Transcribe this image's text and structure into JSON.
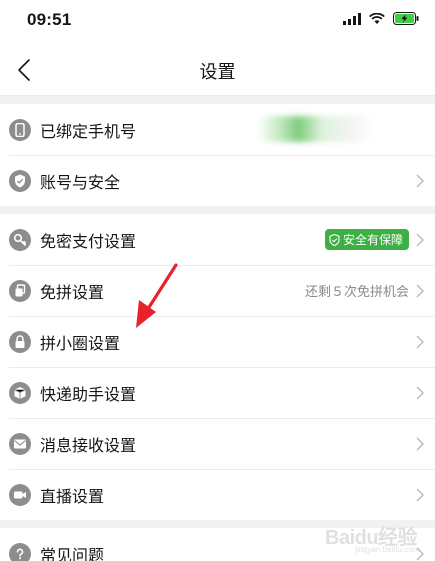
{
  "status": {
    "time": "09:51"
  },
  "nav": {
    "title": "设置"
  },
  "groups": [
    {
      "rows": [
        {
          "label": "已绑定手机号",
          "icon": "phone-icon"
        },
        {
          "label": "账号与安全",
          "icon": "shield-icon"
        }
      ]
    },
    {
      "rows": [
        {
          "label": "免密支付设置",
          "icon": "key-icon",
          "badge": "安全有保障"
        },
        {
          "label": "免拼设置",
          "icon": "copy-icon",
          "hint": "还剩５次免拼机会"
        },
        {
          "label": "拼小圈设置",
          "icon": "lock-icon"
        },
        {
          "label": "快递助手设置",
          "icon": "package-icon"
        },
        {
          "label": "消息接收设置",
          "icon": "mail-icon"
        },
        {
          "label": "直播设置",
          "icon": "video-icon"
        }
      ]
    },
    {
      "rows": [
        {
          "label": "常见问题",
          "icon": "question-icon"
        }
      ]
    }
  ],
  "watermark": {
    "brand": "Baidu经验",
    "sub": "jingyan.baidu.com"
  },
  "colors": {
    "badge_green": "#3daf44",
    "annotation_red": "#e8222a",
    "icon_gray": "#8d8d8d"
  }
}
